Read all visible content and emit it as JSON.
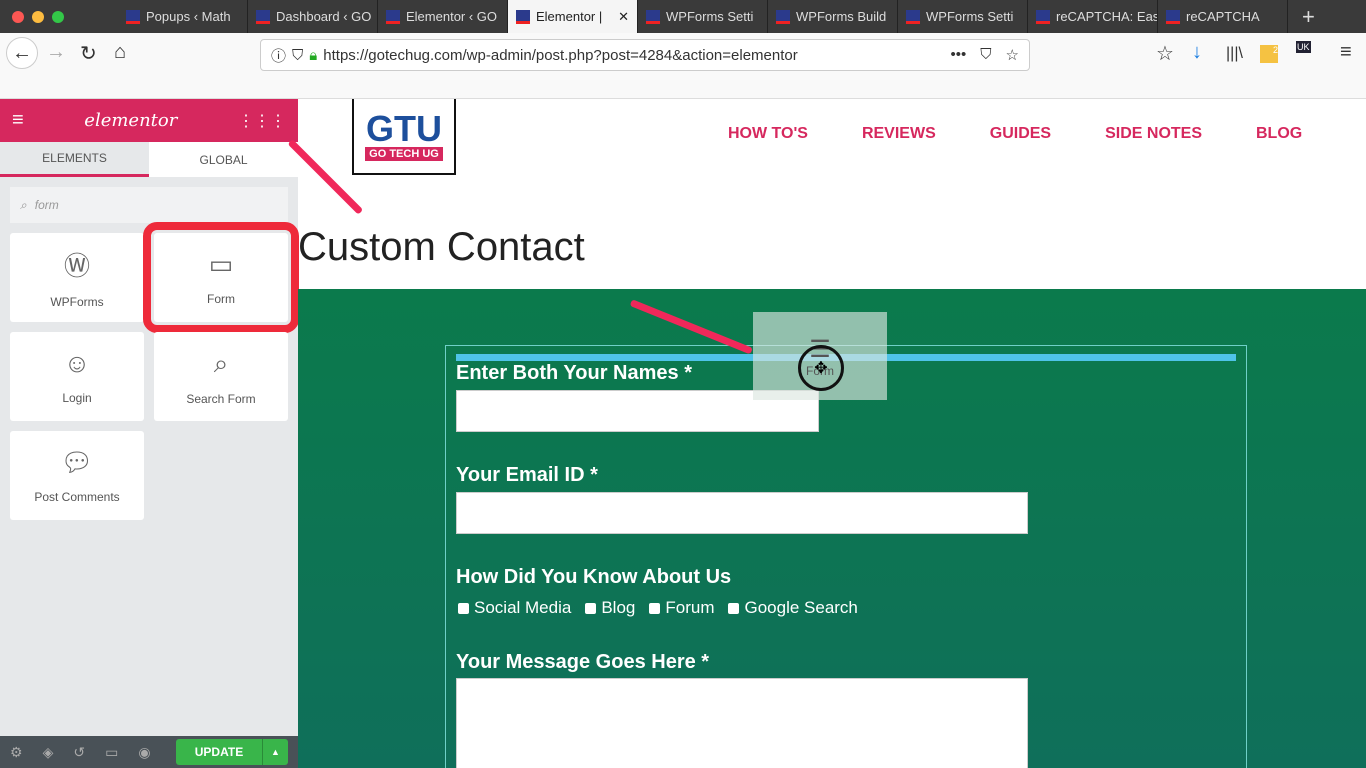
{
  "browser": {
    "tabs": [
      {
        "label": "Popups ‹ Math"
      },
      {
        "label": "Dashboard ‹ GO"
      },
      {
        "label": "Elementor ‹ GO"
      },
      {
        "label": "Elementor |",
        "active": true
      },
      {
        "label": "WPForms Setti"
      },
      {
        "label": "WPForms Build"
      },
      {
        "label": "WPForms Setti"
      },
      {
        "label": "reCAPTCHA: Easy o"
      },
      {
        "label": "reCAPTCHA"
      }
    ],
    "url": "https://gotechug.com/wp-admin/post.php?post=4284&action=elementor",
    "badge_count": "2",
    "uk_badge": "UK"
  },
  "editor": {
    "logo": "elementor",
    "tabs": [
      "ELEMENTS",
      "GLOBAL"
    ],
    "search_placeholder": "form",
    "widgets": [
      {
        "label": "WPForms",
        "icon": "wordpress-icon"
      },
      {
        "label": "Form",
        "icon": "form-icon",
        "highlighted": true
      },
      {
        "label": "Login",
        "icon": "login-icon"
      },
      {
        "label": "Search Form",
        "icon": "search-form-icon"
      },
      {
        "label": "Post Comments",
        "icon": "comments-icon"
      }
    ],
    "update_label": "UPDATE",
    "accent": "#d6285e"
  },
  "site": {
    "logo_main": "GTU",
    "logo_sub": "GO TECH UG",
    "menu": [
      "HOW TO'S",
      "REVIEWS",
      "GUIDES",
      "SIDE NOTES",
      "BLOG"
    ],
    "page_title": "Custom Contact",
    "form": {
      "name_label": "Enter Both Your Names *",
      "email_label": "Your Email ID *",
      "source_label": "How Did You Know About Us",
      "options": [
        "Social Media",
        "Blog",
        "Forum",
        "Google Search"
      ],
      "message_label": "Your Message Goes Here *"
    },
    "drag_ghost_label": "Form"
  }
}
